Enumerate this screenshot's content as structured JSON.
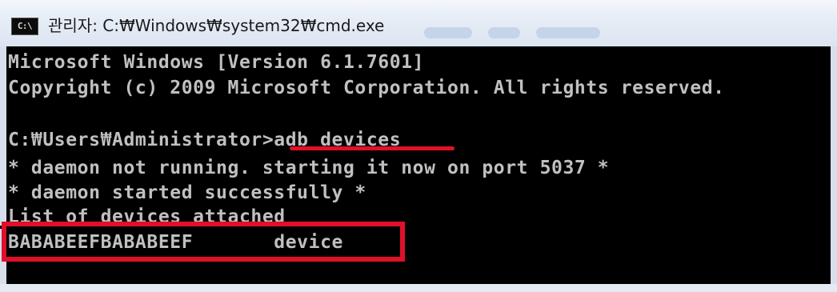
{
  "window": {
    "title": "관리자: C:₩Windows₩system32₩cmd.exe",
    "icon_name": "cmd-icon",
    "icon_label": "C:\\"
  },
  "console": {
    "lines": [
      "Microsoft Windows [Version 6.1.7601]",
      "Copyright (c) 2009 Microsoft Corporation. All rights reserved.",
      "",
      "C:₩Users₩Administrator>adb devices",
      "* daemon not running. starting it now on port 5037 *",
      "* daemon started successfully *",
      "List of devices attached",
      "BABABEEFBABABEEF       device"
    ],
    "text_color": "#c0c0c0",
    "background_color": "#000000"
  },
  "annotations": {
    "highlight_color": "#e0102a"
  }
}
